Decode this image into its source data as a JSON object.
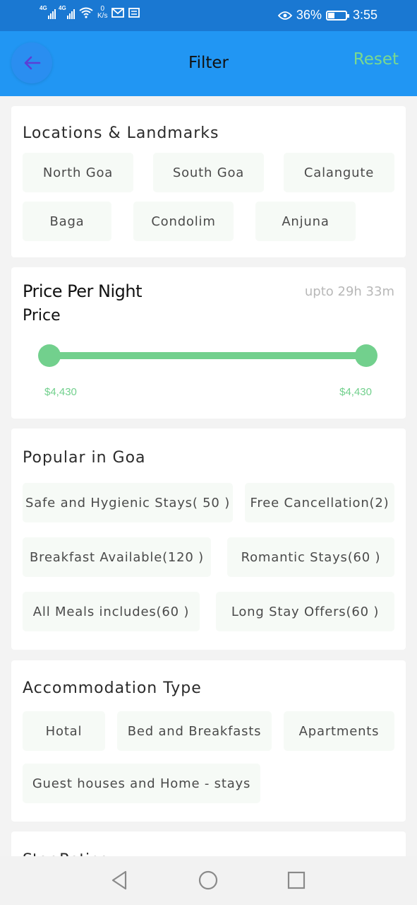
{
  "status_bar": {
    "network1": "4G",
    "network2": "4G",
    "speed_value": "0",
    "speed_unit": "K/s",
    "battery_percent": "36%",
    "battery_level": 0.36,
    "time": "3:55",
    "icons": [
      "signal-icon",
      "signal-icon",
      "wifi-icon",
      "gmail-icon",
      "message-icon",
      "eye-icon",
      "battery-icon"
    ]
  },
  "appbar": {
    "title": "Filter",
    "reset_label": "Reset",
    "back_icon": "arrow-left-icon",
    "colors": {
      "background": "#2196f3",
      "reset": "#7ad98f",
      "back_arrow": "#5b3fd6"
    }
  },
  "locations": {
    "title": "Locations & Landmarks",
    "chips": [
      "North Goa",
      "South Goa",
      "Calangute",
      "Baga",
      "Condolim",
      "Anjuna"
    ]
  },
  "price": {
    "title": "Price Per Night",
    "subtitle": "Price",
    "meta": "upto 29h 33m",
    "min_label": "$4,430",
    "max_label": "$4,430",
    "color": "#72d08d"
  },
  "popular": {
    "title": "Popular in Goa",
    "chips": [
      "Safe and Hygienic Stays( 50 )",
      "Free Cancellation(2)",
      "Breakfast Available(120 )",
      "Romantic Stays(60 )",
      "All Meals includes(60 )",
      "Long Stay Offers(60 )"
    ]
  },
  "accommodation": {
    "title": "Accommodation Type",
    "chips": [
      "Hotal",
      "Bed and Breakfasts",
      "Apartments",
      "Guest houses and Home - stays"
    ]
  },
  "star_rating": {
    "title": "Star Rating"
  },
  "navbar": {
    "icons": [
      "back-triangle-icon",
      "home-circle-icon",
      "recents-square-icon"
    ]
  }
}
